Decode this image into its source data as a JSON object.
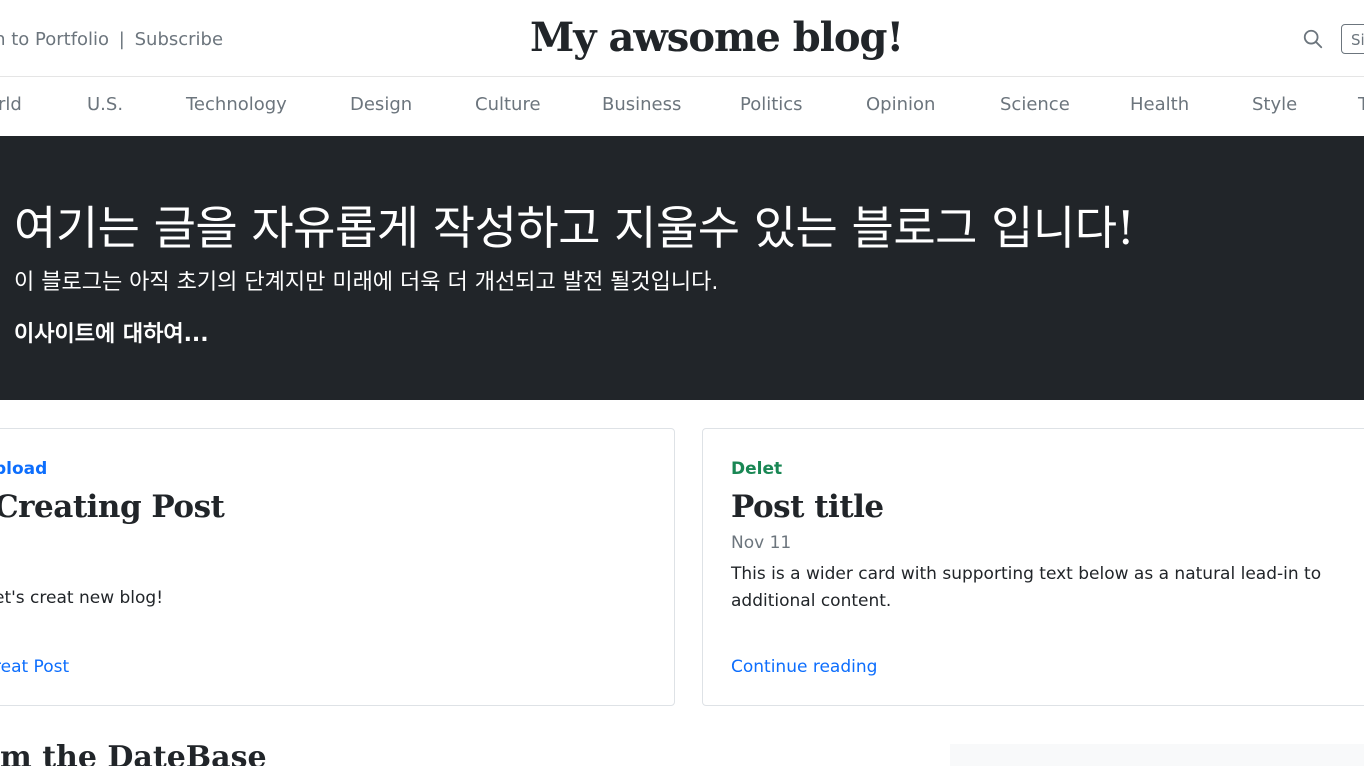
{
  "header": {
    "return_link": "rn to Portfolio",
    "separator": "|",
    "subscribe_link": "Subscribe",
    "site_title": "My awsome blog!",
    "signup_label": "Si"
  },
  "nav": {
    "items": [
      "rld",
      "U.S.",
      "Technology",
      "Design",
      "Culture",
      "Business",
      "Politics",
      "Opinion",
      "Science",
      "Health",
      "Style",
      "T"
    ]
  },
  "hero": {
    "title": "여기는 글을 자유롭게 작성하고 지울수 있는 블로그 입니다!",
    "lead": "이 블로그는 아직 초기의 단계지만 미래에 더욱 더 개선되고 발전 될것입니다.",
    "link": "이사이트에 대하여..."
  },
  "cards": [
    {
      "category": "pload",
      "category_color": "#0d6efd",
      "title": "Creating Post",
      "date": "",
      "text": "et's creat new blog!",
      "link": "reat Post"
    },
    {
      "category": "Delet",
      "category_color": "#198754",
      "title": "Post title",
      "date": "Nov 11",
      "text": "This is a wider card with supporting text below as a natural lead-in to additional content.",
      "link": "Continue reading"
    }
  ],
  "section": {
    "heading": "om the DateBase"
  },
  "colors": {
    "hero_bg": "#212529",
    "link": "#0d6efd",
    "muted": "#6c757d"
  }
}
